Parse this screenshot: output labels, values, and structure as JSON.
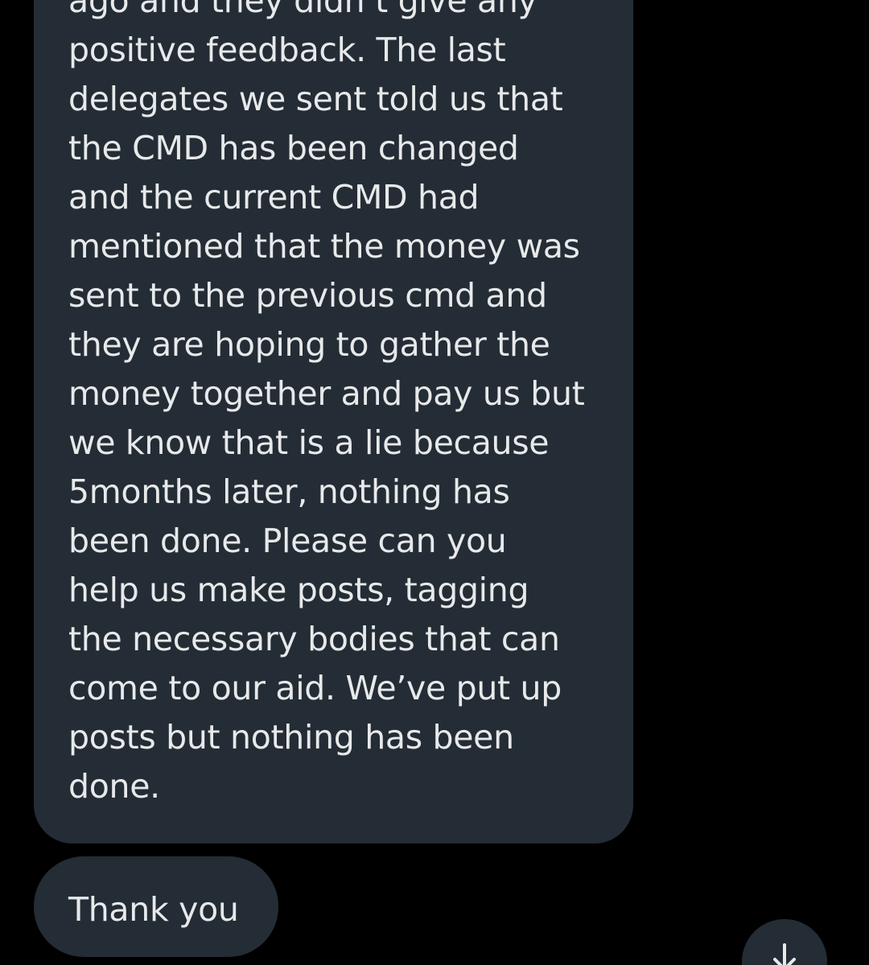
{
  "conversation": {
    "message_lines": [
      "ago and they didn’t give any",
      "positive feedback. The last",
      "delegates we sent told us that",
      "the CMD has been changed",
      "and the current CMD had",
      "mentioned that the money was",
      "sent to the previous cmd and",
      "they are hoping to gather the",
      "money together and pay us but",
      "we know that is a lie because",
      "5months later, nothing has",
      "been done. Please can you",
      "help us make posts, tagging",
      "the necessary bodies that can",
      "come to our aid. We’ve put up",
      "posts but nothing has been",
      "done."
    ],
    "reply_text": "Thank you"
  },
  "controls": {
    "scroll_down_icon": "arrow-down-icon"
  },
  "colors": {
    "background": "#000000",
    "bubble": "#242d35",
    "text": "#e7e9ea"
  }
}
